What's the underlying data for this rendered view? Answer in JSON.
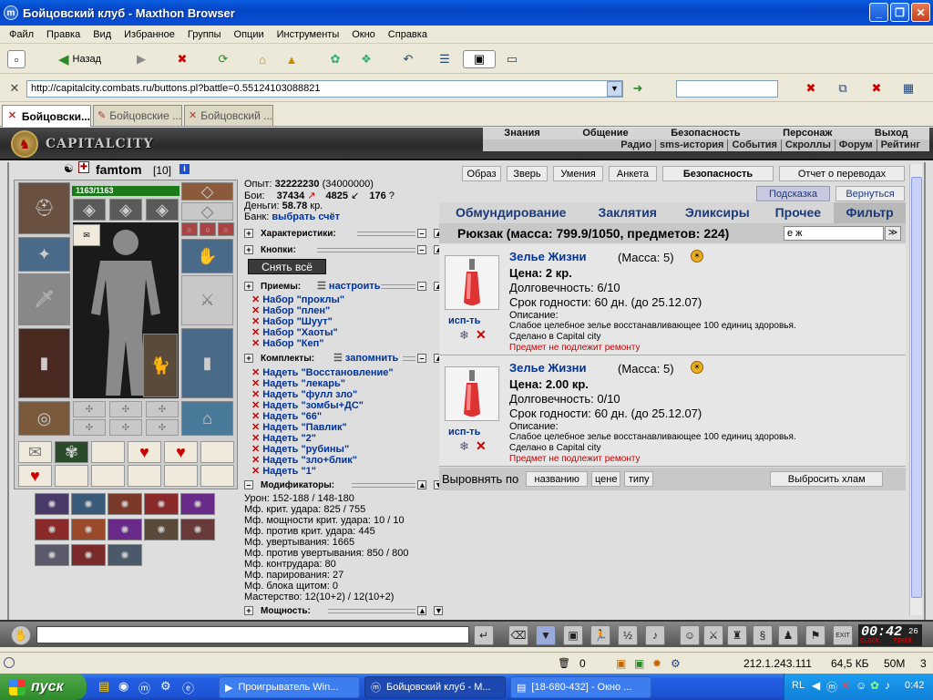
{
  "window": {
    "title": "Бойцовский клуб - Maxthon Browser"
  },
  "menu": [
    "Файл",
    "Правка",
    "Вид",
    "Избранное",
    "Группы",
    "Опции",
    "Инструменты",
    "Окно",
    "Справка"
  ],
  "toolbar": {
    "back_label": "Назад"
  },
  "address": {
    "url": "http://capitalcity.combats.ru/buttons.pl?battle=0.55124103088821"
  },
  "tabs": [
    "Бойцовски...",
    "Бойцовские ...",
    "Бойцовский ..."
  ],
  "game": {
    "logo_text": "CAPITALCITY",
    "nav_top": [
      "Знания",
      "Общение",
      "Безопасность",
      "Персонаж",
      "Выход"
    ],
    "nav_bottom": [
      "Радио",
      "sms-история",
      "События",
      "Скроллы",
      "Форум",
      "Рейтинг"
    ],
    "char": {
      "name": "famtom",
      "level": "[10]",
      "hp": "1163/1163"
    },
    "stats": {
      "exp_label": "Опыт:",
      "exp": "32222230",
      "exp_next": "(34000000)",
      "fights_label": "Бои:",
      "wins": "37434",
      "losses": "4825",
      "draws": "176",
      "money_label": "Деньги:",
      "money": "58.78",
      "money_unit": "кр.",
      "bank_label": "Банк:",
      "bank_link": "выбрать счёт"
    },
    "sections": {
      "chars": "Характеристики:",
      "buttons": "Кнопки:",
      "undress": "Снять всё",
      "moves": "Приемы:",
      "moves_link": "настроить",
      "sets": "Комплекты:",
      "sets_link": "запомнить",
      "mods": "Модификаторы:",
      "power": "Мощность:"
    },
    "moves": [
      "Набор \"проклы\"",
      "Набор \"плен\"",
      "Набор \"Шуут\"",
      "Набор \"Хаоты\"",
      "Набор \"Кеп\""
    ],
    "sets": [
      "Надеть \"Восстановление\"",
      "Надеть \"лекарь\"",
      "Надеть \"фулл зло\"",
      "Надеть \"зомбы+ДС\"",
      "Надеть \"66\"",
      "Надеть \"Павлик\"",
      "Надеть \"2\"",
      "Надеть \"рубины\"",
      "Надеть \"зло+блик\"",
      "Надеть \"1\""
    ],
    "mods": [
      "Урон: 152-188 / 148-180",
      "Мф. крит. удара: 825 / 755",
      "Мф. мощности крит. удара: 10 / 10",
      "Мф. против крит. удара: 445",
      "Мф. увертывания: 1665",
      "Мф. против увертывания: 850 / 800",
      "Мф. контрудара: 80",
      "Мф. парирования: 27",
      "Мф. блока щитом: 0",
      "Мастерство: 12(10+2) / 12(10+2)"
    ],
    "right_buttons": [
      "Образ",
      "Зверь",
      "Умения",
      "Анкета",
      "Безопасность",
      "Отчет о переводах"
    ],
    "hint": "Подсказка",
    "back": "Вернуться",
    "inv_tabs": [
      "Обмундирование",
      "Заклятия",
      "Эликсиры",
      "Прочее",
      "Фильтр"
    ],
    "backpack": "Рюкзак (масса: 799.9/1050, предметов: 224)",
    "filter_value": "е ж",
    "items": [
      {
        "name": "Зелье Жизни",
        "mass": "(Масса: 5)",
        "price": "Цена: 2 кр.",
        "durability": "Долговечность: 6/10",
        "expiry": "Срок годности: 60 дн. (до 25.12.07)",
        "desc_label": "Описание:",
        "desc": "Слабое целебное зелье восстанавливающее 100 единиц здоровья.",
        "made": "Сделано в Capital city",
        "repair": "Предмет не подлежит ремонту",
        "use": "исп-ть"
      },
      {
        "name": "Зелье Жизни",
        "mass": "(Масса: 5)",
        "price": "Цена: 2.00 кр.",
        "durability": "Долговечность: 0/10",
        "expiry": "Срок годности: 60 дн. (до 25.12.07)",
        "desc_label": "Описание:",
        "desc": "Слабое целебное зелье восстанавливающее 100 единиц здоровья.",
        "made": "Сделано в Capital city",
        "repair": "Предмет не подлежит ремонту",
        "use": "исп-ть"
      }
    ],
    "sort_label": "Выровнять по",
    "sort_buttons": [
      "названию",
      "цене",
      "типу"
    ],
    "junk": "Выбросить хлам"
  },
  "clock": {
    "time": "00:42",
    "sec": "26",
    "clock_label": "CLOCK",
    "timer_label": "TIMER",
    "exit_label": "EXIT"
  },
  "status": {
    "count": "0",
    "ip": "212.1.243.111",
    "size": "64,5 КБ",
    "mem": "50M",
    "num": "3"
  },
  "taskbar": {
    "start": "пуск",
    "tasks": [
      "Проигрыватель Win...",
      "Бойцовский клуб - M...",
      "[18-680-432] - Окно ..."
    ],
    "lang": "RL",
    "time": "0:42"
  }
}
